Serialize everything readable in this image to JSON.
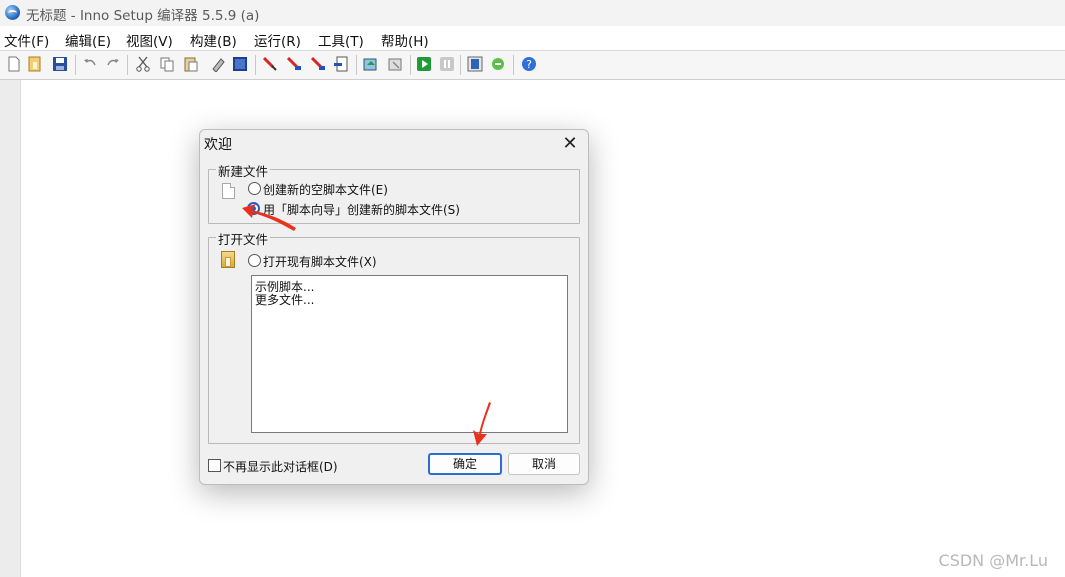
{
  "window": {
    "title": "无标题 - Inno Setup 编译器 5.5.9 (a)"
  },
  "menu": [
    "文件(F)",
    "编辑(E)",
    "视图(V)",
    "构建(B)",
    "运行(R)",
    "工具(T)",
    "帮助(H)"
  ],
  "toolbar_icons": [
    "new-file-icon",
    "open-file-icon",
    "save-icon",
    "undo-icon",
    "redo-icon",
    "cut-icon",
    "copy-icon",
    "paste-icon",
    "clear-icon",
    "select-all-icon",
    "breakpoint-icon",
    "breakpoint-toggle-icon",
    "breakpoint-clear-icon",
    "output-icon",
    "compile-icon",
    "compile-stop-icon",
    "run-icon",
    "pause-icon",
    "target-icon",
    "debug-icon",
    "help-icon"
  ],
  "dialog": {
    "title": "欢迎",
    "close": "✕",
    "new_group": {
      "label": "新建文件",
      "option_empty": "创建新的空脚本文件(E)",
      "option_wizard": "用「脚本向导」创建新的脚本文件(S)"
    },
    "open_group": {
      "label": "打开文件",
      "option_existing": "打开现有脚本文件(X)",
      "list_items": [
        "示例脚本...",
        "更多文件..."
      ]
    },
    "dont_show": "不再显示此对话框(D)",
    "ok": "确定",
    "cancel": "取消"
  },
  "watermark": "CSDN @Mr.Lu",
  "colors": {
    "accent": "#1b63c6",
    "annotation": "#e8321e"
  }
}
